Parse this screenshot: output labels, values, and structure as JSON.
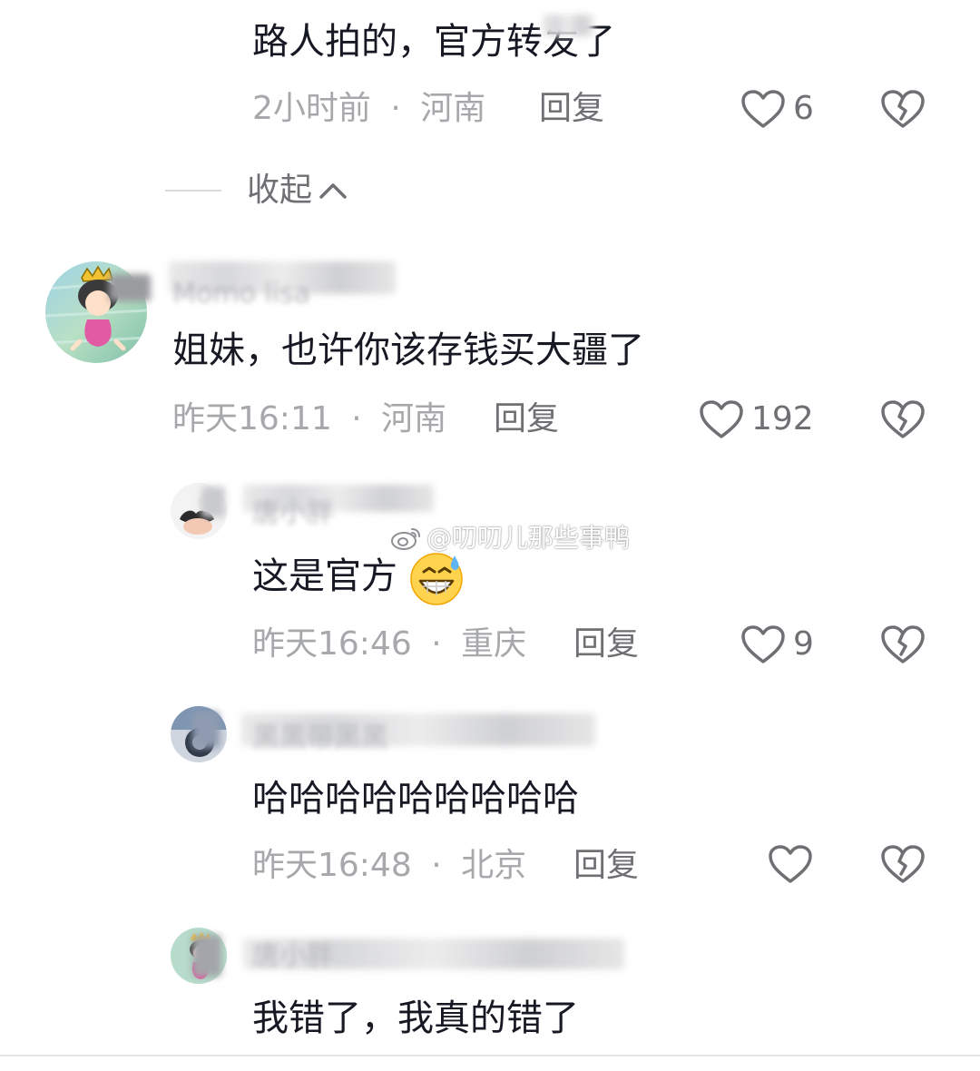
{
  "colors": {
    "text_primary": "#161823",
    "text_meta": "#a7a8ab",
    "text_action": "#6f7074",
    "divider": "#d9dadc"
  },
  "top_comment": {
    "text": "路人拍的，官方转发了",
    "time": "2小时前",
    "location": "河南",
    "reply_label": "回复",
    "likes": "6",
    "like_icon": "heart-outline-icon",
    "dislike_icon": "broken-heart-icon"
  },
  "collapse": {
    "label": "收起",
    "icon": "chevron-up-icon"
  },
  "comments": [
    {
      "username": "Momo lisa",
      "text": "姐妹，也许你该存钱买大疆了",
      "time": "昨天16:11",
      "location": "河南",
      "reply_label": "回复",
      "likes": "192"
    },
    {
      "username": "唐小胖",
      "text": "这是官方",
      "emoji": "grinning-sweat-emoji",
      "time": "昨天16:46",
      "location": "重庆",
      "reply_label": "回复",
      "likes": "9"
    },
    {
      "username": "黑黑带黑黑",
      "text": "哈哈哈哈哈哈哈哈哈",
      "time": "昨天16:48",
      "location": "北京",
      "reply_label": "回复",
      "likes": ""
    },
    {
      "username": "唐小胖",
      "text": "我错了，我真的错了"
    }
  ],
  "watermark": {
    "text": "@叨叨儿那些事鸭",
    "icon": "weibo-icon"
  },
  "separator": "·"
}
